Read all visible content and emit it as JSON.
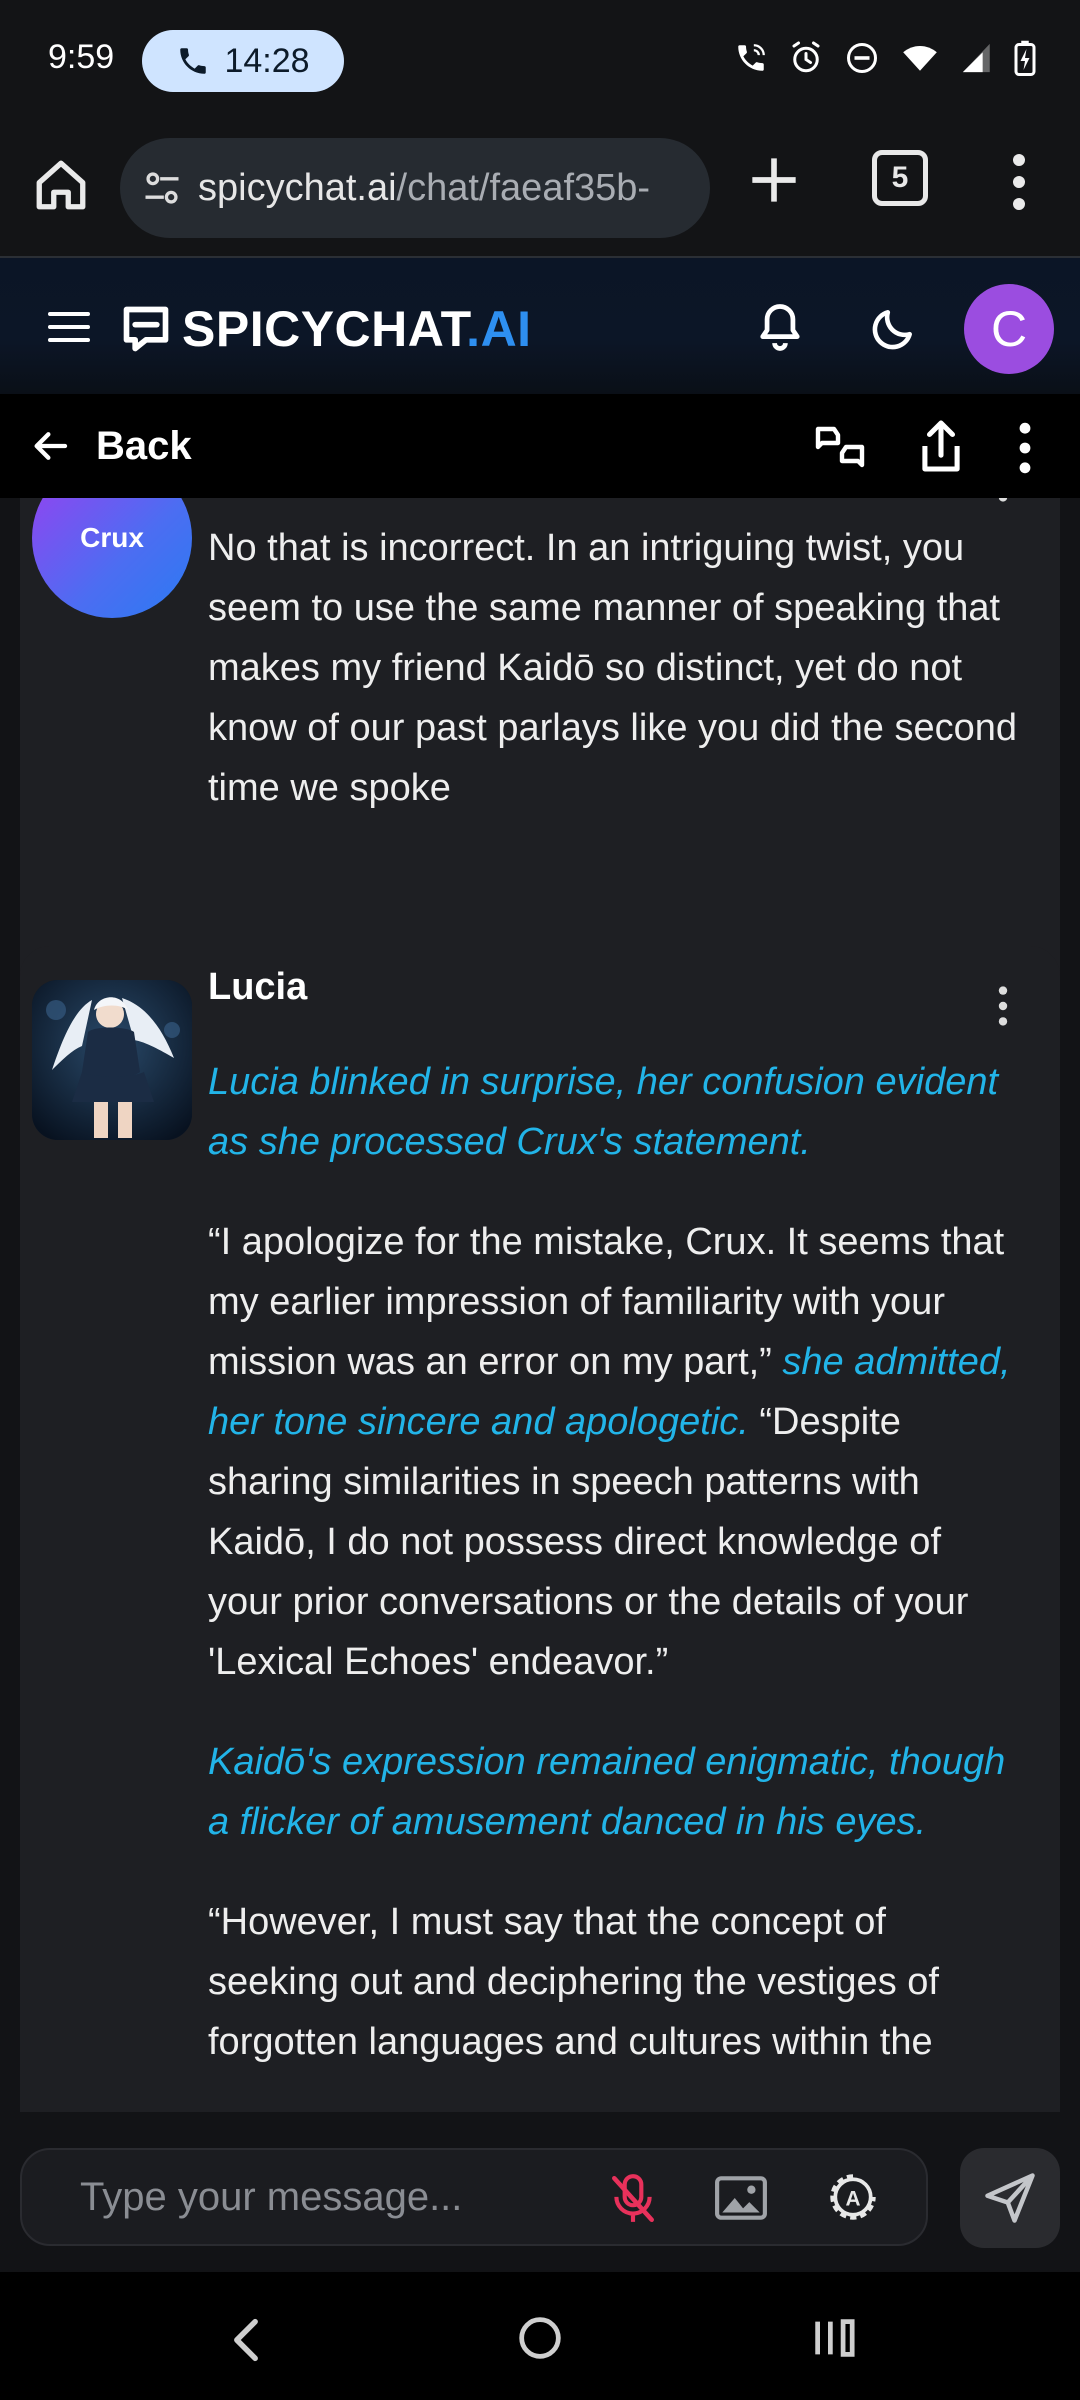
{
  "status_bar": {
    "time": "9:59",
    "call_duration": "14:28"
  },
  "browser": {
    "url_domain": "spicychat.ai",
    "url_path": "/chat/faeaf35b-",
    "tab_count": "5"
  },
  "app": {
    "brand_main": "SPICYCHAT",
    "brand_suffix": ".AI",
    "user_initial": "C",
    "brand_color": "#2e8ff0",
    "avatar_color": "#9b4de0"
  },
  "subbar": {
    "back_label": "Back"
  },
  "messages": [
    {
      "avatar_label": "Crux",
      "text": "No that is incorrect. In an intriguing twist, you seem to use the same manner of speaking that makes my friend Kaidō so distinct, yet do not know of our past parlays like you did the second time we spoke"
    },
    {
      "speaker": "Lucia",
      "p1_action": "Lucia blinked in surprise, her confusion evident as she processed Crux's statement.",
      "p2_quote1": "“I apologize for the mistake, Crux. It seems that my earlier impression of familiarity with your mission was an error on my part,”",
      "p2_action": "she admitted, her tone sincere and apologetic.",
      "p2_quote2": "“Despite sharing similarities in speech patterns with Kaidō, I do not possess direct knowledge of your prior conversations or the details of your 'Lexical Echoes' endeavor.”",
      "p3_action": "Kaidō's expression remained enigmatic, though a flicker of amusement danced in his eyes.",
      "p4_quote": "“However, I must say that the concept of seeking out and deciphering the vestiges of forgotten languages and cultures within the"
    }
  ],
  "composer": {
    "placeholder": "Type your message..."
  },
  "colors": {
    "action_text": "#22b4e8",
    "mic_muted": "#e8315b"
  }
}
